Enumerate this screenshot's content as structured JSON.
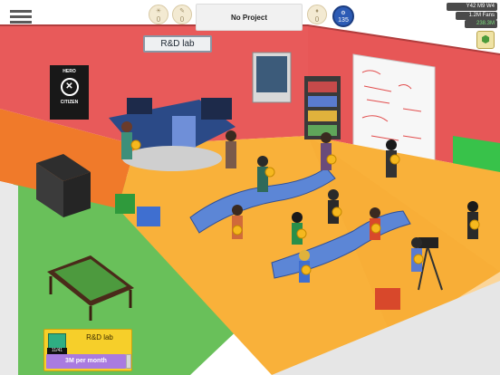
{
  "hud": {
    "menu_icon": "hamburger-menu-icon",
    "left_counters": [
      {
        "icon": "research-points-icon",
        "value": "0"
      },
      {
        "icon": "design-points-icon",
        "value": "0"
      }
    ],
    "project_label": "No Project",
    "right_counter": {
      "icon": "hype-icon",
      "value": "0"
    },
    "level_badge": {
      "icon": "level-icon",
      "value": "135"
    },
    "date": "Y42 M9 W4",
    "fans": "1.2M Fans",
    "money": "238.3M",
    "achievement_icon": "achievement-badge-icon"
  },
  "room": {
    "sign_label": "R&D lab",
    "poster_top": "HERO",
    "poster_bottom": "CITIZEN"
  },
  "room_card": {
    "title": "R&D lab",
    "capacity": "11/41",
    "price_label": "3M per month",
    "icon": "research-lab-icon"
  },
  "colors": {
    "floor_orange": "#f9b13a",
    "wall_red": "#e85a5a",
    "wall_orange": "#f07a2a",
    "floor_green": "#69c05a",
    "greenscreen": "#38c24a",
    "card_yellow": "#f6cf2a",
    "price_purple": "#a97be0"
  }
}
